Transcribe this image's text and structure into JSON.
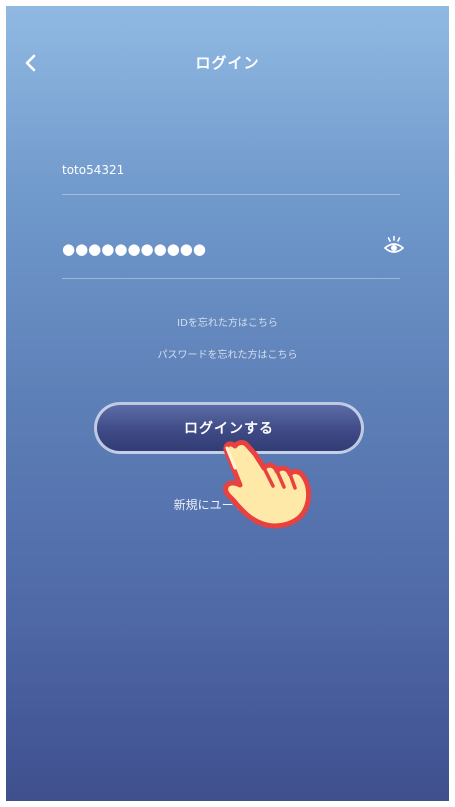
{
  "header": {
    "title": "ログイン",
    "back_icon": "chevron-left-icon"
  },
  "form": {
    "user_id_value": "toto54321",
    "password_value": "●●●●●●●●●●●",
    "show_password_icon": "eye-icon"
  },
  "links": {
    "forgot_id": "IDを忘れた方はこちら",
    "forgot_password": "パスワードを忘れた方はこちら"
  },
  "actions": {
    "login_label": "ログインする",
    "register_label": "新規にユーザー登録"
  },
  "overlay": {
    "pointer_icon": "pointing-hand-icon"
  },
  "colors": {
    "background_top": "#90b9e2",
    "background_bottom": "#3f4f8e",
    "button": "#3f4a86",
    "hand_fill": "#ffe9a8",
    "hand_outline": "#e8413f"
  }
}
